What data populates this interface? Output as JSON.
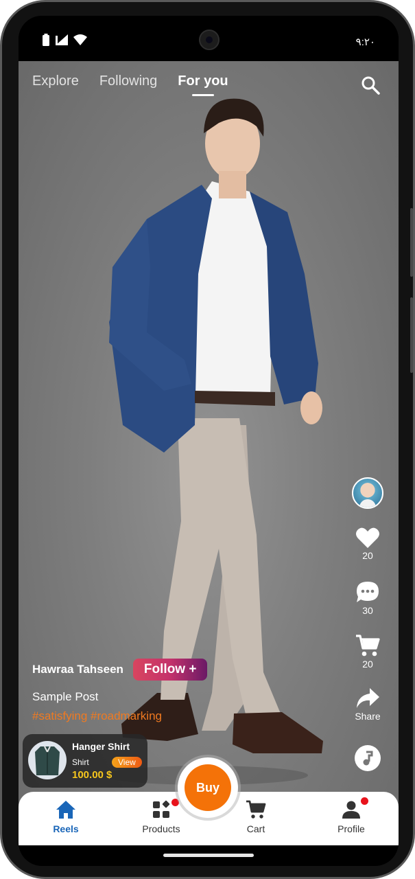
{
  "status_bar": {
    "time": "٩:٢٠"
  },
  "top_tabs": [
    {
      "label": "Explore",
      "active": false
    },
    {
      "label": "Following",
      "active": false
    },
    {
      "label": "For you",
      "active": true
    }
  ],
  "rail": {
    "likes": "20",
    "comments": "30",
    "cart_count": "20",
    "share_label": "Share"
  },
  "post": {
    "username": "Hawraa Tahseen",
    "follow_label": "Follow +",
    "caption": "Sample Post",
    "hashtags": "#satisfying #roadmarking"
  },
  "product": {
    "name": "Hanger Shirt",
    "type": "Shirt",
    "view_label": "View",
    "price": "100.00 $"
  },
  "buy_label": "Buy",
  "bottom_nav": [
    {
      "label": "Reels",
      "icon": "home-icon",
      "active": true
    },
    {
      "label": "Products",
      "icon": "grid-icon",
      "active": false,
      "badge": true
    },
    {
      "label": "Cart",
      "icon": "cart-icon",
      "active": false
    },
    {
      "label": "Profile",
      "icon": "person-icon",
      "active": false,
      "badge": true
    }
  ],
  "colors": {
    "accent": "#f47208",
    "nav_active": "#1a66b8",
    "hashtag": "#f07a21",
    "price": "#f6c61d",
    "badge": "#e8131c"
  }
}
